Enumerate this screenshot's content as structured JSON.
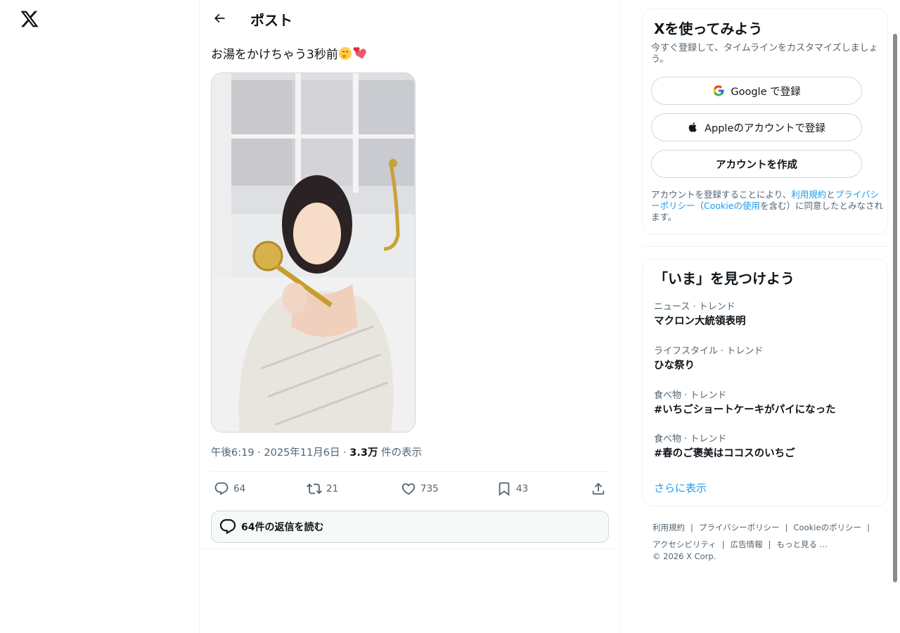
{
  "colors": {
    "text": "#0f1419",
    "muted": "#536471",
    "link": "#1d9bf0",
    "border": "#eff3f4"
  },
  "nav": {
    "logo_icon": "x-logo-icon"
  },
  "header": {
    "title": "ポスト",
    "back_icon": "arrow-left-icon"
  },
  "post": {
    "text": "お湯をかけちゃう3秒前",
    "emojis": [
      "shushing-face-emoji",
      "two-hearts-emoji"
    ],
    "media_alt": "バスローブ姿で金色のシャワーヘッドを持つ女性の写真",
    "time": "午後6:19",
    "date": "2025年11月6日",
    "views_count": "3.3万",
    "views_label": "件の表示",
    "dot": "·"
  },
  "actions": {
    "replies": "64",
    "reposts": "21",
    "likes": "735",
    "bookmarks": "43"
  },
  "read_replies": "64件の返信を読む",
  "signup": {
    "title": "Xを使ってみよう",
    "subtitle": "今すぐ登録して、タイムラインをカスタマイズしましょう。",
    "google_button": "Google で登録",
    "apple_button": "Appleのアカウントで登録",
    "create_button": "アカウントを作成",
    "legal_1": "アカウントを登録することにより、",
    "legal_terms": "利用規約",
    "legal_2": "と",
    "legal_privacy": "プライバシーポリシー",
    "legal_3": "（",
    "legal_cookie": "Cookieの使用",
    "legal_4": "を含む）に同意したとみなされます。"
  },
  "trends": {
    "title": "「いま」を見つけよう",
    "items": [
      {
        "category": "ニュース · トレンド",
        "name": "マクロン大統領表明"
      },
      {
        "category": "ライフスタイル · トレンド",
        "name": "ひな祭り"
      },
      {
        "category": "食べ物 · トレンド",
        "name": "#いちごショートケーキがパイになった"
      },
      {
        "category": "食べ物 · トレンド",
        "name": "#春のご褒美はココスのいちご"
      }
    ],
    "show_more": "さらに表示"
  },
  "footer": {
    "links": [
      "利用規約",
      "プライバシーポリシー",
      "Cookieのポリシー",
      "アクセシビリティ",
      "広告情報",
      "もっと見る …"
    ],
    "separator": "|",
    "copyright": "© 2026 X Corp."
  }
}
